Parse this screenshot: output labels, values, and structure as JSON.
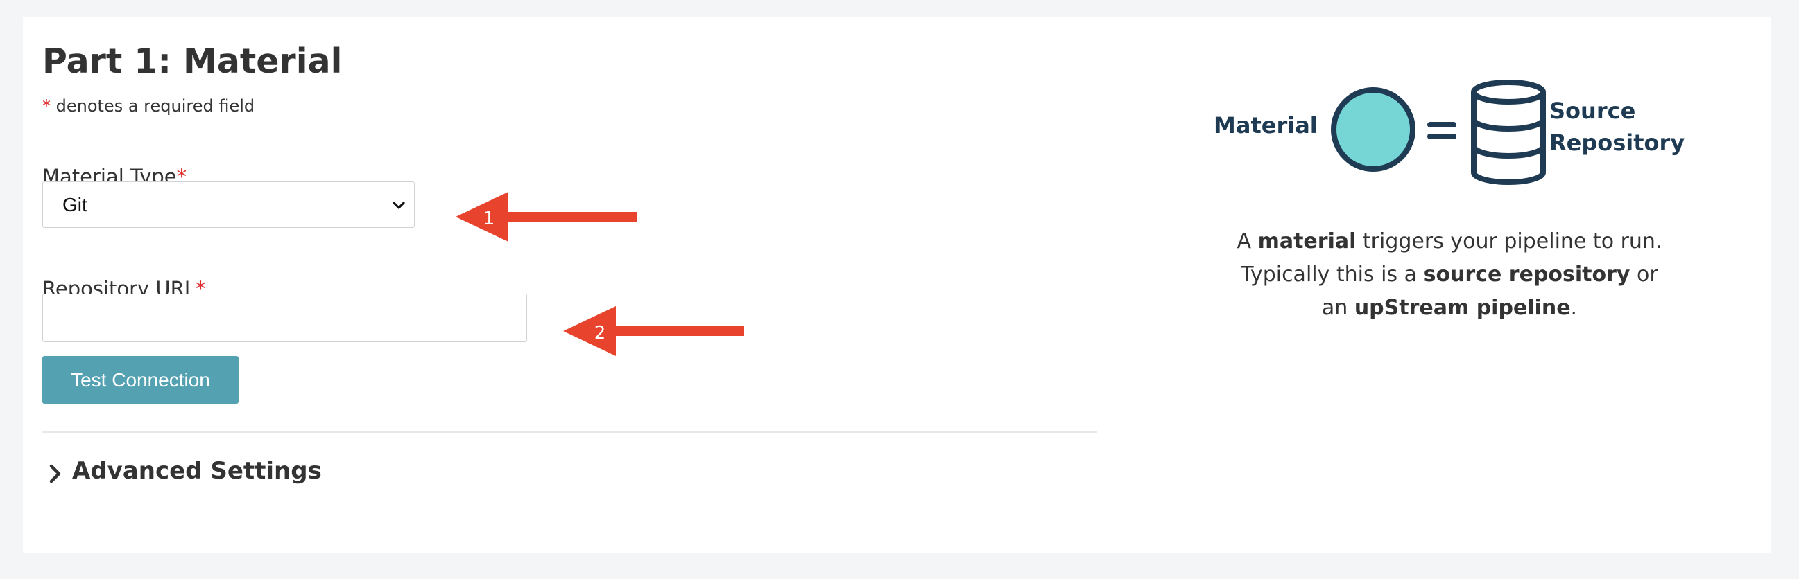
{
  "form": {
    "title": "Part 1: Material",
    "required_star": "*",
    "required_note": " denotes a required field",
    "material_type": {
      "label": "Material Type",
      "star": "*",
      "value": "Git"
    },
    "repo_url": {
      "label": "Repository URL",
      "star": "*",
      "value": ""
    },
    "test_button": "Test Connection",
    "advanced_label": "Advanced Settings"
  },
  "annotations": {
    "arrow1": "1",
    "arrow2": "2",
    "color": "#e8432d"
  },
  "diagram": {
    "material_label": "Material",
    "equals": "=",
    "source_line1": "Source",
    "source_line2": "Repository",
    "circle_color": "#76d6d6",
    "stroke_color": "#1f3b53"
  },
  "description": {
    "p1_a": "A ",
    "p1_b": "material",
    "p1_c": " triggers your pipeline to run.",
    "p2_a": "Typically this is a ",
    "p2_b": "source repository",
    "p2_c": " or",
    "p3_a": "an ",
    "p3_b": "upStream pipeline",
    "p3_c": "."
  },
  "colors": {
    "required": "#e02a2a",
    "button": "#54a1b2",
    "background": "#f3f5f6"
  }
}
